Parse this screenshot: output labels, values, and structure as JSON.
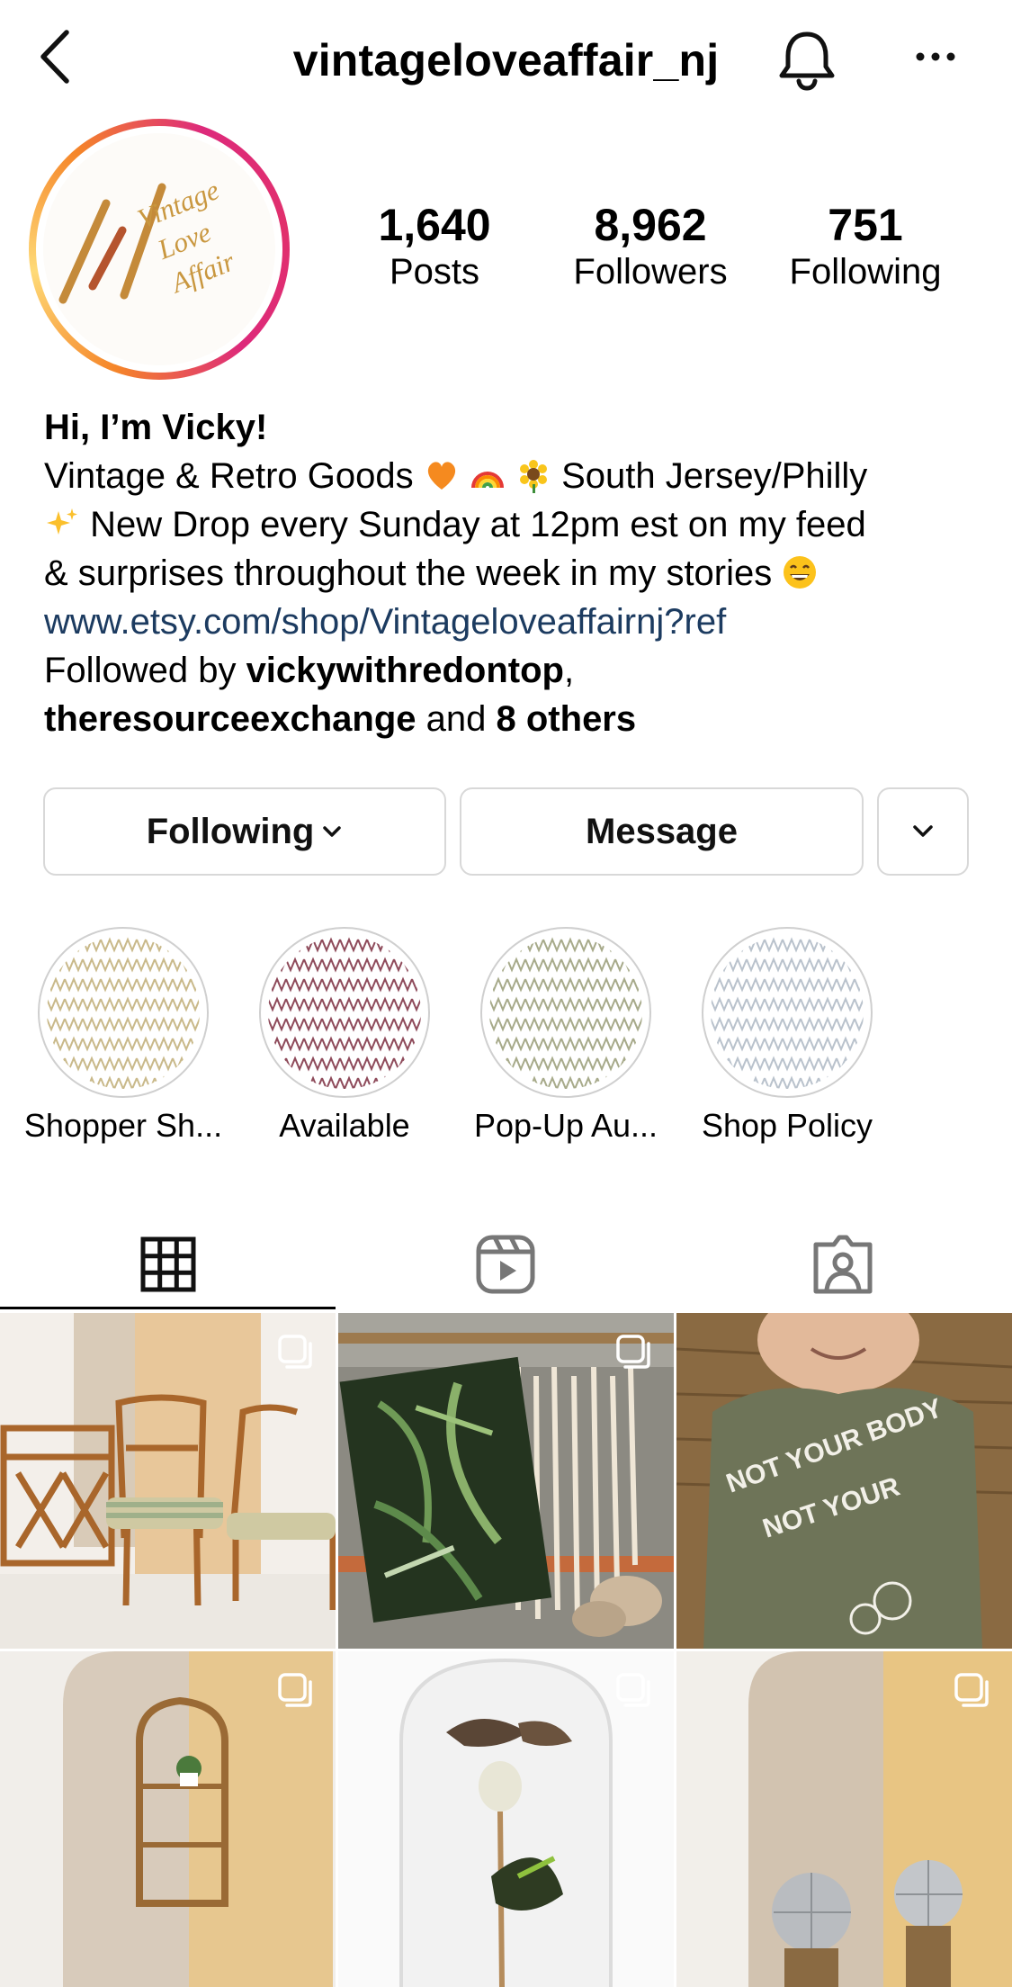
{
  "header": {
    "username": "vintageloveaffair_nj"
  },
  "profile": {
    "avatar_text": [
      "Vintage",
      "Love",
      "Affair"
    ],
    "stats": [
      {
        "value": "1,640",
        "label": "Posts"
      },
      {
        "value": "8,962",
        "label": "Followers"
      },
      {
        "value": "751",
        "label": "Following"
      }
    ]
  },
  "bio": {
    "name": "Hi, I’m Vicky!",
    "line1_a": "Vintage & Retro Goods",
    "line1_b": "South Jersey/Philly",
    "line2": "New Drop every Sunday at 12pm est on my feed",
    "line3": "& surprises throughout the week in my stories",
    "link": "www.etsy.com/shop/Vintageloveaffairnj?ref",
    "followed_prefix": "Followed by",
    "followed_user1": "vickywithredontop",
    "followed_user2": "theresourceexchange",
    "followed_and": "and",
    "followed_others": "8 others"
  },
  "actions": {
    "following_label": "Following",
    "message_label": "Message"
  },
  "highlights": [
    {
      "label": "Shopper Sh...",
      "color": "#c9b98a"
    },
    {
      "label": "Available",
      "color": "#8e4a5a"
    },
    {
      "label": "Pop-Up Au...",
      "color": "#a7aa8a"
    },
    {
      "label": "Shop Policy",
      "color": "#b9c2cc"
    }
  ],
  "tabs": [
    "grid-icon",
    "reels-icon",
    "tagged-icon"
  ],
  "posts": [
    {
      "name": "rattan-chairs",
      "multi": true
    },
    {
      "name": "fern-notebook",
      "multi": true
    },
    {
      "name": "tshirt",
      "multi": false,
      "shirt_text": [
        "NOT YOUR BODY",
        "NOT YOUR"
      ]
    },
    {
      "name": "wicker-shelf",
      "multi": true
    },
    {
      "name": "butterfly-dome",
      "multi": true
    },
    {
      "name": "disco-balls",
      "multi": true
    }
  ]
}
